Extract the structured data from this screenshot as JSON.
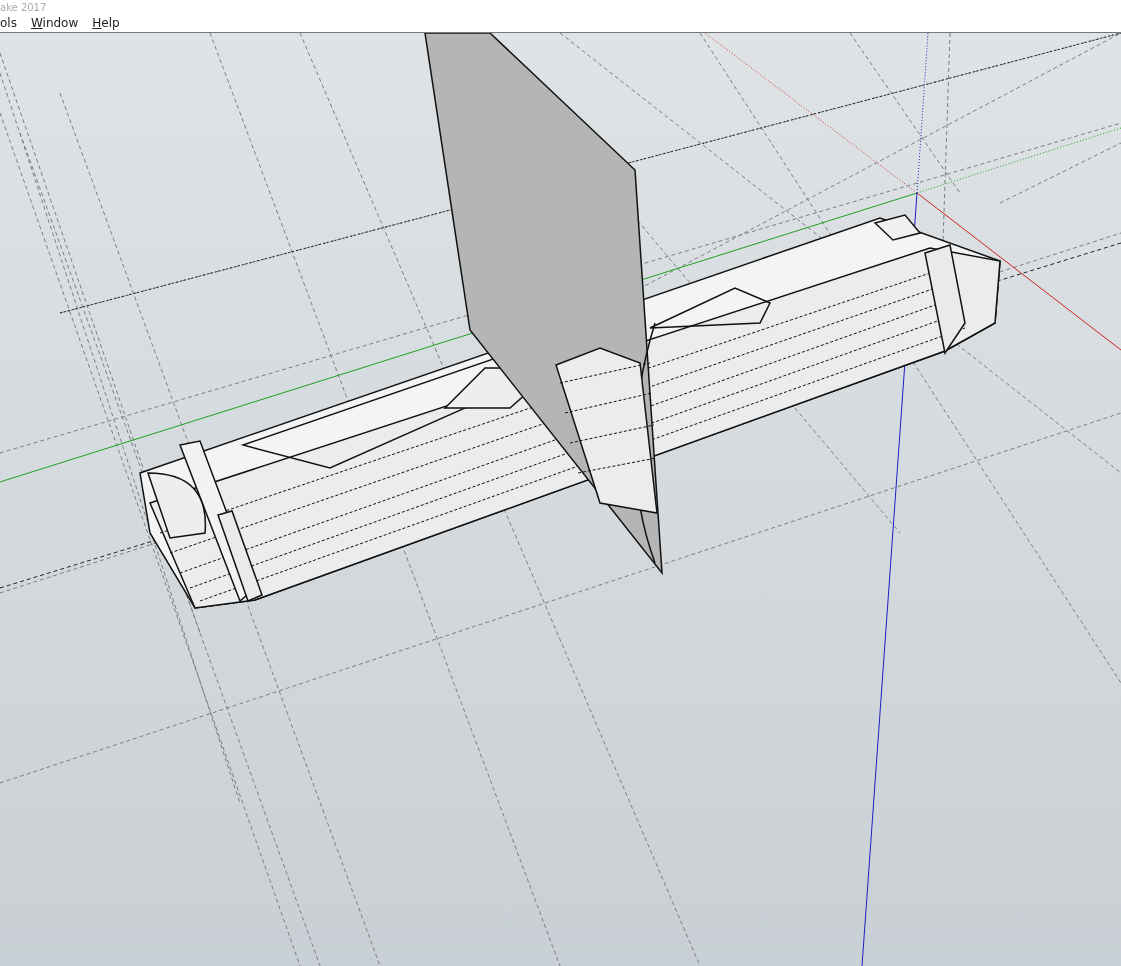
{
  "window": {
    "title": "ake 2017"
  },
  "menu": [
    {
      "label": "ols",
      "mnemonic": false
    },
    {
      "label": "Window",
      "mnemonic": true
    },
    {
      "label": "Help",
      "mnemonic": true
    }
  ]
}
